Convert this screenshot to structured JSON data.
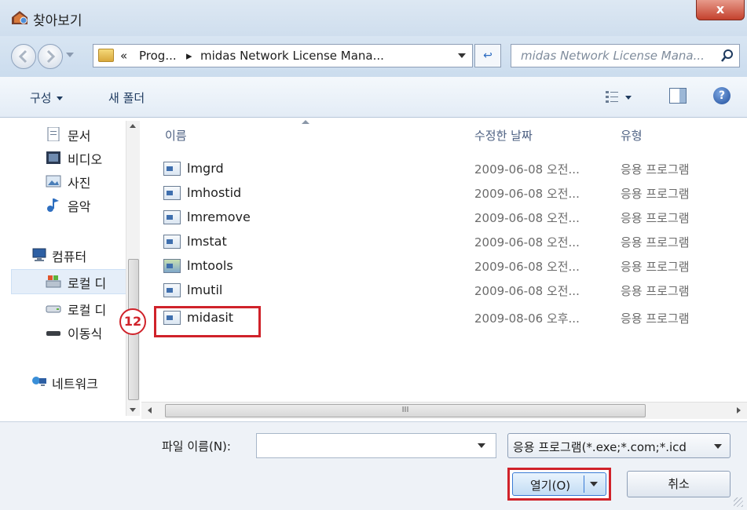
{
  "window": {
    "title": "찾아보기",
    "close_label": "x"
  },
  "navbar": {
    "breadcrumb": [
      "«",
      "Prog...",
      "▸",
      "midas Network License Mana..."
    ],
    "refresh_label": "↩",
    "search_placeholder": "midas Network License Mana..."
  },
  "toolbar": {
    "organize_label": "구성",
    "new_folder_label": "새 폴더",
    "help_label": "?"
  },
  "sidebar": {
    "items": [
      {
        "label": "문서",
        "icon": "document-icon"
      },
      {
        "label": "비디오",
        "icon": "video-icon"
      },
      {
        "label": "사진",
        "icon": "picture-icon"
      },
      {
        "label": "음악",
        "icon": "music-icon"
      },
      {
        "label": "컴퓨터",
        "icon": "computer-icon"
      },
      {
        "label": "로컬 디",
        "icon": "local-disk-icon",
        "selected": true
      },
      {
        "label": "로컬 디",
        "icon": "drive-icon"
      },
      {
        "label": "이동식",
        "icon": "removable-drive-icon"
      },
      {
        "label": "네트워크",
        "icon": "network-icon"
      }
    ]
  },
  "file_list": {
    "headers": {
      "name": "이름",
      "date": "수정한 날짜",
      "type": "유형"
    },
    "rows": [
      {
        "name": "lmgrd",
        "date": "2009-06-08 오전...",
        "type": "응용 프로그램",
        "icon": "exe-icon"
      },
      {
        "name": "lmhostid",
        "date": "2009-06-08 오전...",
        "type": "응용 프로그램",
        "icon": "exe-icon"
      },
      {
        "name": "lmremove",
        "date": "2009-06-08 오전...",
        "type": "응용 프로그램",
        "icon": "exe-icon"
      },
      {
        "name": "lmstat",
        "date": "2009-06-08 오전...",
        "type": "응용 프로그램",
        "icon": "exe-icon"
      },
      {
        "name": "lmtools",
        "date": "2009-06-08 오전...",
        "type": "응용 프로그램",
        "icon": "tools-exe-icon"
      },
      {
        "name": "lmutil",
        "date": "2009-06-08 오전...",
        "type": "응용 프로그램",
        "icon": "exe-icon"
      },
      {
        "name": "midasit",
        "date": "2009-08-06 오후...",
        "type": "응용 프로그램",
        "icon": "exe-icon",
        "highlighted": true
      }
    ]
  },
  "annotation": {
    "step_number": "12",
    "color": "#d0222a"
  },
  "scrollbar": {
    "thumb_mark": "III"
  },
  "bottom": {
    "filename_label": "파일 이름(N):",
    "filename_value": "",
    "filter_value": "응용 프로그램(*.exe;*.com;*.icd",
    "open_label": "열기(O)",
    "cancel_label": "취소"
  }
}
